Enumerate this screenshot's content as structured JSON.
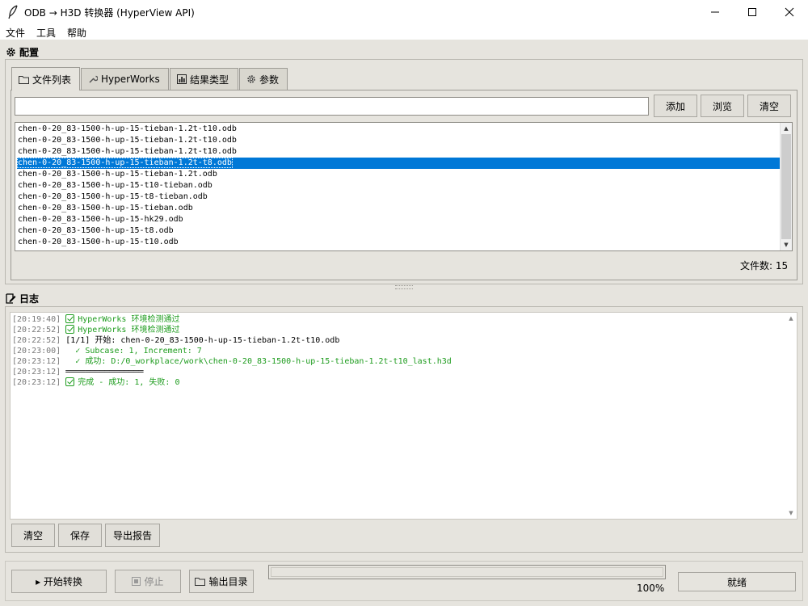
{
  "window": {
    "title": "ODB → H3D 转换器 (HyperView API)",
    "icon": "feather-icon"
  },
  "menu": {
    "items": [
      "文件",
      "工具",
      "帮助"
    ]
  },
  "config": {
    "header": "配置",
    "tabs": [
      {
        "label": "文件列表",
        "icon": "folder-icon",
        "active": true
      },
      {
        "label": "HyperWorks",
        "icon": "wrench-icon",
        "active": false
      },
      {
        "label": "结果类型",
        "icon": "bar-chart-icon",
        "active": false
      },
      {
        "label": "参数",
        "icon": "gear-icon",
        "active": false
      }
    ],
    "path_input": {
      "value": "",
      "placeholder": ""
    },
    "buttons": {
      "add": "添加",
      "browse": "浏览",
      "clear": "清空"
    },
    "files": [
      "chen-0-20_83-1500-h-up-15-tieban-1.2t-t10.odb",
      "chen-0-20_83-1500-h-up-15-tieban-1.2t-t10.odb",
      "chen-0-20_83-1500-h-up-15-tieban-1.2t-t10.odb",
      "chen-0-20_83-1500-h-up-15-tieban-1.2t-t8.odb",
      "chen-0-20_83-1500-h-up-15-tieban-1.2t.odb",
      "chen-0-20_83-1500-h-up-15-t10-tieban.odb",
      "chen-0-20_83-1500-h-up-15-t8-tieban.odb",
      "chen-0-20_83-1500-h-up-15-tieban.odb",
      "chen-0-20_83-1500-h-up-15-hk29.odb",
      "chen-0-20_83-1500-h-up-15-t8.odb",
      "chen-0-20_83-1500-h-up-15-t10.odb"
    ],
    "selected_index": 3,
    "file_count_label": "文件数: 15"
  },
  "log": {
    "header": "日志",
    "lines": [
      {
        "ts": "[20:19:40]",
        "check": true,
        "text": "HyperWorks 环境检测通过",
        "style": "ok"
      },
      {
        "ts": "[20:22:52]",
        "check": true,
        "text": "HyperWorks 环境检测通过",
        "style": "ok"
      },
      {
        "ts": "[20:22:52]",
        "check": false,
        "text": "[1/1] 开始: chen-0-20_83-1500-h-up-15-tieban-1.2t-t10.odb",
        "style": "plain"
      },
      {
        "ts": "[20:23:00]",
        "check": false,
        "text": "  ✓ Subcase: 1, Increment: 7",
        "style": "ok"
      },
      {
        "ts": "[20:23:12]",
        "check": false,
        "text": "  ✓ 成功: D:/0_workplace/work\\chen-0-20_83-1500-h-up-15-tieban-1.2t-t10_last.h3d",
        "style": "ok"
      },
      {
        "ts": "[20:23:12]",
        "check": false,
        "text": "════════════════",
        "style": "plain"
      },
      {
        "ts": "[20:23:12]",
        "check": true,
        "text": "完成 - 成功: 1, 失败: 0",
        "style": "ok"
      }
    ],
    "buttons": {
      "clear": "清空",
      "save": "保存",
      "export": "导出报告"
    }
  },
  "footer": {
    "start": "▸ 开始转换",
    "stop": "停止",
    "output_dir": "输出目录",
    "progress_value": 1.0,
    "progress_label": "100%",
    "status": "就绪"
  }
}
